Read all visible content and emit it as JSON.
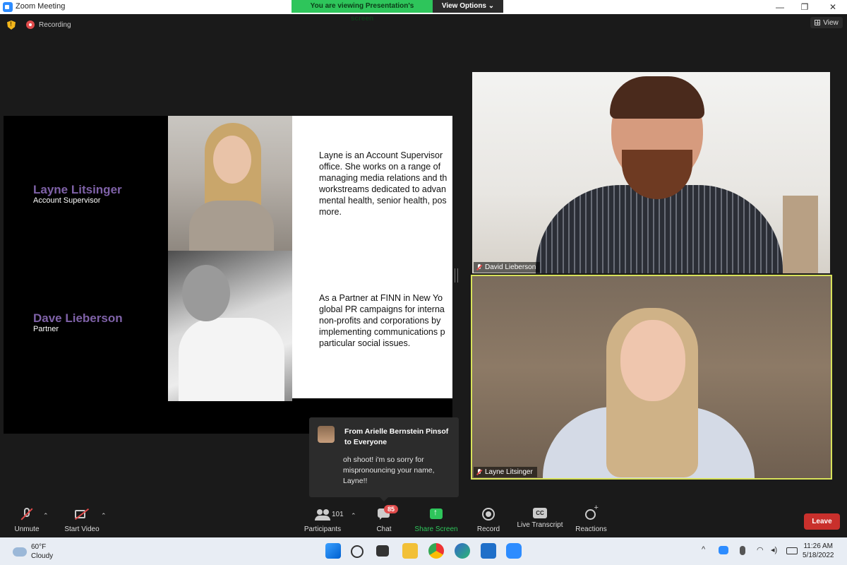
{
  "window": {
    "title": "Zoom Meeting",
    "controls": [
      "—",
      "❐",
      "✕"
    ]
  },
  "share_banner": {
    "viewing": "You are viewing Presentation's screen",
    "options": "View Options ⌄"
  },
  "meeting": {
    "recording_label": "Recording",
    "view_label": "View"
  },
  "slide": {
    "people": [
      {
        "name": "Layne Litsinger",
        "role": "Account Supervisor",
        "bio": [
          "Layne is an Account Supervisor",
          "office. She works on a range of",
          "managing media relations and th",
          "workstreams dedicated to advan",
          "mental health, senior health, pos",
          "more."
        ]
      },
      {
        "name": "Dave Lieberson",
        "role": "Partner",
        "bio": [
          "As a Partner at FINN in New Yo",
          "global PR campaigns for interna",
          "non-profits and corporations by",
          "implementing communications p",
          "particular social issues."
        ]
      }
    ]
  },
  "videos": [
    {
      "name": "David Lieberson"
    },
    {
      "name": "Layne Litsinger"
    }
  ],
  "chat_popup": {
    "from": "From Arielle Bernstein Pinsof to Everyone",
    "message": "oh shoot! i'm so sorry for mispronouncing your name, Layne!!"
  },
  "toolbar": {
    "unmute": "Unmute",
    "start_video": "Start Video",
    "participants": "Participants",
    "participants_count": "101",
    "chat": "Chat",
    "chat_badge": "85",
    "share_screen": "Share Screen",
    "record": "Record",
    "live_transcript": "Live Transcript",
    "cc": "CC",
    "reactions": "Reactions",
    "leave": "Leave",
    "caret": "⌃"
  },
  "taskbar": {
    "temperature": "60°F",
    "condition": "Cloudy",
    "time": "11:26 AM",
    "date": "5/18/2022"
  },
  "colors": {
    "share_green": "#2ec55b",
    "leave_red": "#c9302c",
    "active_speaker": "#d8e25a",
    "slide_name_purple": "#7f62a8"
  }
}
